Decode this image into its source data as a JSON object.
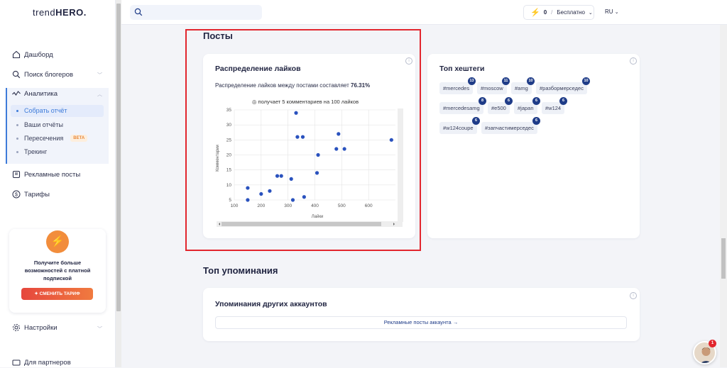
{
  "app": {
    "logo_normal": "trend",
    "logo_bold": "HERO."
  },
  "sidebar": {
    "items": [
      {
        "label": "Дашборд",
        "icon": "home-icon"
      },
      {
        "label": "Поиск блогеров",
        "icon": "search-icon"
      },
      {
        "label": "Аналитика",
        "icon": "analytics-icon"
      },
      {
        "label": "Рекламные посты",
        "icon": "ads-icon"
      },
      {
        "label": "Тарифы",
        "icon": "dollar-icon"
      },
      {
        "label": "Настройки",
        "icon": "settings-icon"
      },
      {
        "label": "Для партнеров",
        "icon": "partners-icon"
      }
    ],
    "analytics_sub": [
      {
        "label": "Собрать отчёт"
      },
      {
        "label": "Ваши отчёты"
      },
      {
        "label": "Пересечения",
        "badge": "BETA"
      },
      {
        "label": "Трекинг"
      }
    ],
    "promo": {
      "text": "Получите больше возможностей с платной подпиской",
      "button": "СМЕНИТЬ ТАРИФ"
    }
  },
  "topbar": {
    "search_placeholder": "",
    "plan_count": "0",
    "plan_sep": "/",
    "plan_name": "Бесплатно",
    "lang": "RU"
  },
  "posts": {
    "section_title": "Посты",
    "likes_card": {
      "title": "Распределение лайков",
      "desc_prefix": "Распределение лайков между постами составляет",
      "desc_value": "76.31%",
      "chart_caption": "◎ получает 5 комментариев на 100 лайков"
    },
    "hashtags_card": {
      "title": "Топ хештеги",
      "tags": [
        {
          "tag": "#mercedes",
          "count": "13"
        },
        {
          "tag": "#moscow",
          "count": "11"
        },
        {
          "tag": "#amg",
          "count": "10"
        },
        {
          "tag": "#разбормерседес",
          "count": "10"
        },
        {
          "tag": "#mercedesamg",
          "count": "8"
        },
        {
          "tag": "#e500",
          "count": "6"
        },
        {
          "tag": "#japan",
          "count": "6"
        },
        {
          "tag": "#w124",
          "count": "6"
        },
        {
          "tag": "#w124coupe",
          "count": "6"
        },
        {
          "tag": "#запчастимерседес",
          "count": "6"
        }
      ]
    }
  },
  "mentions": {
    "section_title": "Топ упоминания",
    "card_title": "Упоминания других аккаунтов",
    "button": "Рекламные посты аккаунта →"
  },
  "chat": {
    "badge": "1"
  },
  "chart_data": {
    "type": "scatter",
    "title": "◎ получает 5 комментариев на 100 лайков",
    "xlabel": "Лайки",
    "ylabel": "Комментарии",
    "xlim": [
      100,
      700
    ],
    "ylim": [
      5,
      35
    ],
    "xticks": [
      100,
      200,
      300,
      400,
      500,
      600
    ],
    "yticks": [
      5,
      10,
      15,
      20,
      25,
      30,
      35
    ],
    "grid": true,
    "points": [
      [
        150,
        9
      ],
      [
        150,
        5
      ],
      [
        200,
        7
      ],
      [
        232,
        8
      ],
      [
        260,
        13
      ],
      [
        275,
        13
      ],
      [
        312,
        12
      ],
      [
        318,
        5
      ],
      [
        330,
        34
      ],
      [
        335,
        26
      ],
      [
        355,
        26
      ],
      [
        360,
        6
      ],
      [
        408,
        14
      ],
      [
        412,
        20
      ],
      [
        480,
        22
      ],
      [
        488,
        27
      ],
      [
        510,
        22
      ],
      [
        685,
        25
      ]
    ],
    "color": "#2a52be"
  }
}
